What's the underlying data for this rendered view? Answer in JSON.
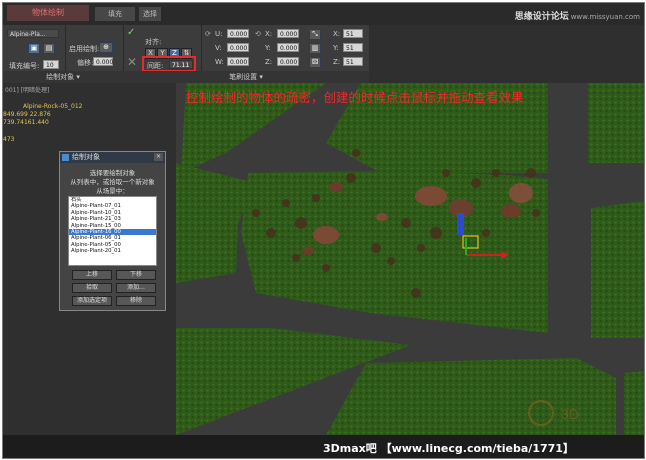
{
  "app": {
    "tab_active": "物体绘制",
    "tab_2": "填充",
    "tab_3": "选择",
    "tab_4": "",
    "watermark_top_cn": "思缘设计论坛",
    "watermark_top_url": "www.missyuan.com"
  },
  "toolbar": {
    "object_field": "Alpine-Pla...",
    "fill_number_label": "填充编号:",
    "fill_number_value": "10",
    "fill_section_title": "绘制对象",
    "use_grid_label": "启用绘制:",
    "offset_label": "偏移:",
    "offset_value": "0.000",
    "align_label": "对齐:",
    "spacing_label": "间距:",
    "spacing_value": "71.11",
    "brush_section_title": "笔刷设置",
    "axes": [
      "X",
      "Y",
      "Z"
    ],
    "u_label": "U:",
    "u_value": "0.000",
    "v_label": "V:",
    "v_value": "0.000",
    "w_label": "W:",
    "w_value": "0.000",
    "x_label": "X:",
    "x_value": "0.000",
    "y_label": "Y:",
    "y_value": "0.000",
    "z_label": "Z:",
    "z_value": "0.000",
    "sx_label": "X:",
    "sx_value": "51",
    "sy_label": "Y:",
    "sy_value": "51",
    "sz_label": "Z:",
    "sz_value": "51"
  },
  "left_panel": {
    "header": "001] [明暗处理]",
    "object_name": "Alpine-Rock-05_012",
    "coords_1": "849.699 22.876",
    "coords_2": "739.74161.440",
    "number": "473"
  },
  "viewport": {
    "caption": "控制绘制的物体的疏密，创建的时候点击鼠标并拖动查看效果",
    "watermark_logo": "3D"
  },
  "dialog": {
    "title": "绘制对象",
    "line1": "选择要绘制对象",
    "line2": "从列表中，或拾取一个新对象",
    "line3": "从场景中：",
    "items": [
      "石头",
      "Alpine-Plant-07_01",
      "Alpine-Plant-10_01",
      "Alpine-Plant-21_03",
      "Alpine-Plant-15_00",
      "Alpine-Plant-16_00",
      "Alpine-Plant-06_01",
      "Alpine-Plant-05_00",
      "Alpine-Plant-20_01"
    ],
    "selected_index": 5,
    "btn_up": "上移",
    "btn_down": "下移",
    "btn_pick": "拾取",
    "btn_add": "添加...",
    "btn_add_selected": "添加选定项",
    "btn_remove": "移除"
  },
  "footer": {
    "watermark": "3Dmax吧 【www.linecg.com/tieba/1771】"
  }
}
